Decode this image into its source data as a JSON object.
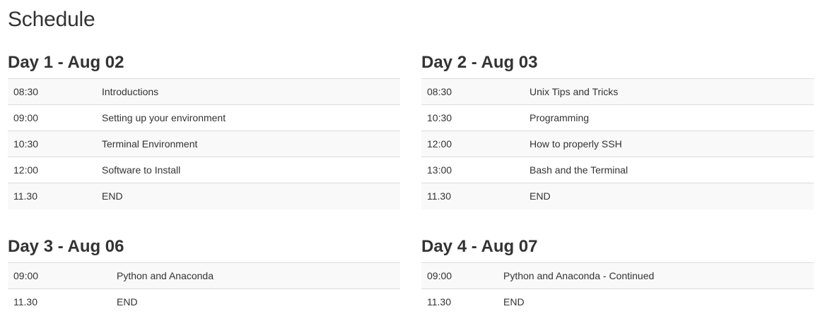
{
  "page": {
    "title": "Schedule"
  },
  "days": [
    {
      "heading": "Day 1 - Aug 02",
      "rows": [
        {
          "time": "08:30",
          "event": "Introductions"
        },
        {
          "time": "09:00",
          "event": "Setting up your environment"
        },
        {
          "time": "10:30",
          "event": "Terminal Environment"
        },
        {
          "time": "12:00",
          "event": "Software to Install"
        },
        {
          "time": "11.30",
          "event": "END"
        }
      ]
    },
    {
      "heading": "Day 2 - Aug 03",
      "rows": [
        {
          "time": "08:30",
          "event": "Unix Tips and Tricks"
        },
        {
          "time": "10:30",
          "event": "Programming"
        },
        {
          "time": "12:00",
          "event": "How to properly SSH"
        },
        {
          "time": "13:00",
          "event": "Bash and the Terminal"
        },
        {
          "time": "11.30",
          "event": "END"
        }
      ]
    },
    {
      "heading": "Day 3 - Aug 06",
      "rows": [
        {
          "time": "09:00",
          "event": "Python and Anaconda"
        },
        {
          "time": "11.30",
          "event": "END"
        }
      ]
    },
    {
      "heading": "Day 4 - Aug 07",
      "rows": [
        {
          "time": "09:00",
          "event": "Python and Anaconda - Continued"
        },
        {
          "time": "11.30",
          "event": "END"
        }
      ]
    }
  ],
  "colors": {
    "text": "#333333",
    "row_stripe": "#f9f9f9",
    "row_border": "#dddddd",
    "background": "#ffffff"
  }
}
